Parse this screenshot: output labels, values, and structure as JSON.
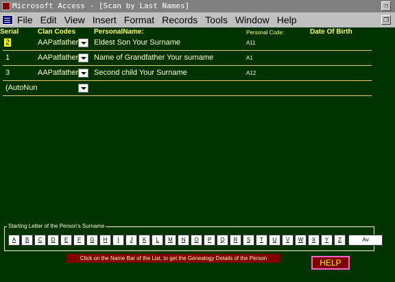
{
  "window": {
    "title": "Microsoft Access - [Scan by Last Names]",
    "restore_glyph": "❐",
    "close_glyph": "❐"
  },
  "menu": [
    "File",
    "Edit",
    "View",
    "Insert",
    "Format",
    "Records",
    "Tools",
    "Window",
    "Help"
  ],
  "columns": {
    "serial": "Serial",
    "clan": "Clan Codes",
    "person": "PersonalName:",
    "code": "Personal Code:",
    "dob": "Date Of Birth"
  },
  "rows": [
    {
      "serial": "2",
      "clan": "AAPatfather",
      "name": "Eldest Son   Your Surname",
      "code": "A11"
    },
    {
      "serial": "1",
      "clan": "AAPatfather",
      "name": "Name of Grandfather   Your surname",
      "code": "A1"
    },
    {
      "serial": "3",
      "clan": "AAPatfather",
      "name": "Second child   Your Surname",
      "code": "A12"
    },
    {
      "serial": "(AutoNun",
      "clan": "",
      "name": "",
      "code": ""
    }
  ],
  "surname_panel": {
    "label": "Starting Letter of the Person's Surname",
    "letters": [
      "A",
      "B",
      "C",
      "D",
      "E",
      "F",
      "G",
      "H",
      "I",
      "J",
      "K",
      "L",
      "M",
      "N",
      "O",
      "P",
      "Q",
      "R",
      "S",
      "T",
      "U",
      "V",
      "W",
      "X",
      "Y",
      "Z"
    ],
    "last_button": "Av"
  },
  "hint": "Click on the Name Bar of the List, to get the Genealogy Details of the Person",
  "help_button": "HELP"
}
